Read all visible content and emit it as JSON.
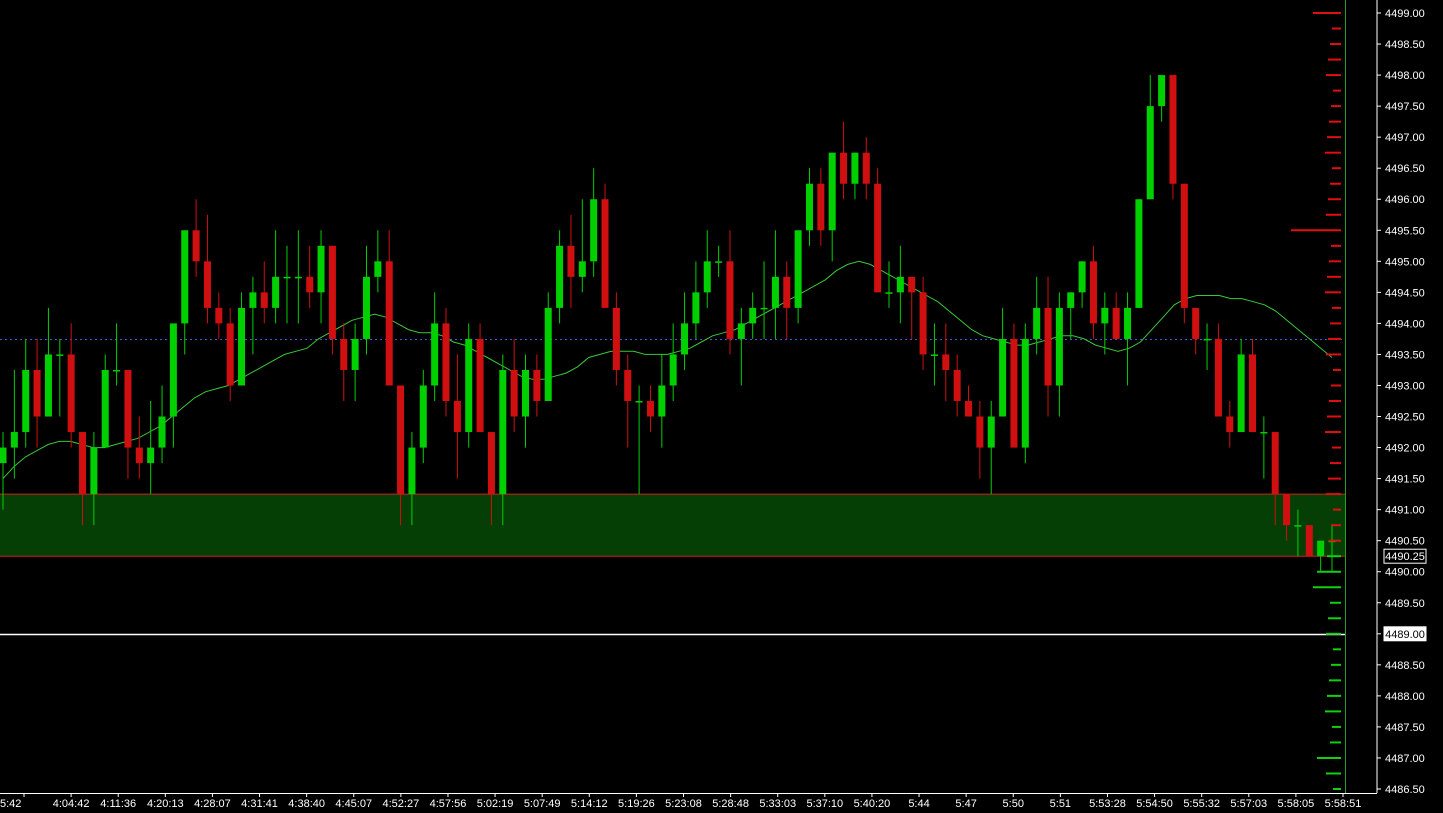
{
  "chart_data": {
    "type": "candlestick",
    "y_axis": {
      "min": 4486.5,
      "max": 4499.0,
      "ticks": [
        "4499.00",
        "4498.50",
        "4498.00",
        "4497.50",
        "4497.00",
        "4496.50",
        "4496.00",
        "4495.50",
        "4495.00",
        "4494.50",
        "4494.00",
        "4493.50",
        "4493.00",
        "4492.50",
        "4492.00",
        "4491.50",
        "4491.00",
        "4490.50",
        "4490.00",
        "4489.50",
        "4489.00",
        "4488.50",
        "4488.00",
        "4487.50",
        "4487.00",
        "4486.50"
      ]
    },
    "x_axis": {
      "labels": [
        "5:42",
        "4:04:42",
        "4:11:36",
        "4:20:13",
        "4:28:07",
        "4:31:41",
        "4:38:40",
        "4:45:07",
        "4:52:27",
        "4:57:56",
        "5:02:19",
        "5:07:49",
        "5:14:12",
        "5:19:26",
        "5:23:08",
        "5:28:48",
        "5:33:03",
        "5:37:10",
        "5:40:20",
        "5:44",
        "5:47",
        "5:50",
        "5:51",
        "5:53:28",
        "5:54:50",
        "5:55:32",
        "5:57:03",
        "5:58:05",
        "5:58:51"
      ]
    },
    "candles": [
      {
        "o": 4491.75,
        "h": 4492.25,
        "l": 4491.0,
        "c": 4492.0
      },
      {
        "o": 4492.0,
        "h": 4493.25,
        "l": 4491.5,
        "c": 4492.25
      },
      {
        "o": 4492.25,
        "h": 4493.75,
        "l": 4492.0,
        "c": 4493.25
      },
      {
        "o": 4493.25,
        "h": 4493.75,
        "l": 4492.0,
        "c": 4492.5
      },
      {
        "o": 4492.5,
        "h": 4494.25,
        "l": 4492.5,
        "c": 4493.5
      },
      {
        "o": 4493.5,
        "h": 4493.75,
        "l": 4492.5,
        "c": 4493.5
      },
      {
        "o": 4493.5,
        "h": 4494.0,
        "l": 4492.0,
        "c": 4492.25
      },
      {
        "o": 4492.25,
        "h": 4492.25,
        "l": 4490.75,
        "c": 4491.25
      },
      {
        "o": 4491.25,
        "h": 4492.25,
        "l": 4490.75,
        "c": 4492.0
      },
      {
        "o": 4492.0,
        "h": 4493.5,
        "l": 4492.0,
        "c": 4493.25
      },
      {
        "o": 4493.25,
        "h": 4494.0,
        "l": 4493.0,
        "c": 4493.25
      },
      {
        "o": 4493.25,
        "h": 4493.25,
        "l": 4491.5,
        "c": 4492.0
      },
      {
        "o": 4492.0,
        "h": 4492.5,
        "l": 4491.5,
        "c": 4491.75
      },
      {
        "o": 4491.75,
        "h": 4492.75,
        "l": 4491.25,
        "c": 4492.0
      },
      {
        "o": 4492.0,
        "h": 4493.0,
        "l": 4491.75,
        "c": 4492.5
      },
      {
        "o": 4492.5,
        "h": 4493.75,
        "l": 4492.0,
        "c": 4494.0
      },
      {
        "o": 4494.0,
        "h": 4495.5,
        "l": 4493.5,
        "c": 4495.5
      },
      {
        "o": 4495.5,
        "h": 4496.0,
        "l": 4494.75,
        "c": 4495.0
      },
      {
        "o": 4495.0,
        "h": 4495.75,
        "l": 4494.0,
        "c": 4494.25
      },
      {
        "o": 4494.25,
        "h": 4494.5,
        "l": 4493.75,
        "c": 4494.0
      },
      {
        "o": 4494.0,
        "h": 4494.25,
        "l": 4492.75,
        "c": 4493.0
      },
      {
        "o": 4493.0,
        "h": 4494.5,
        "l": 4493.0,
        "c": 4494.25
      },
      {
        "o": 4494.25,
        "h": 4494.75,
        "l": 4493.5,
        "c": 4494.5
      },
      {
        "o": 4494.5,
        "h": 4495.0,
        "l": 4494.0,
        "c": 4494.25
      },
      {
        "o": 4494.25,
        "h": 4495.5,
        "l": 4494.0,
        "c": 4494.75
      },
      {
        "o": 4494.75,
        "h": 4495.25,
        "l": 4494.0,
        "c": 4494.75
      },
      {
        "o": 4494.75,
        "h": 4495.5,
        "l": 4494.0,
        "c": 4494.75
      },
      {
        "o": 4494.75,
        "h": 4495.25,
        "l": 4494.25,
        "c": 4494.5
      },
      {
        "o": 4494.5,
        "h": 4495.5,
        "l": 4494.0,
        "c": 4495.25
      },
      {
        "o": 4495.25,
        "h": 4495.25,
        "l": 4493.5,
        "c": 4493.75
      },
      {
        "o": 4493.75,
        "h": 4494.0,
        "l": 4492.75,
        "c": 4493.25
      },
      {
        "o": 4493.25,
        "h": 4494.0,
        "l": 4492.75,
        "c": 4493.75
      },
      {
        "o": 4493.75,
        "h": 4495.25,
        "l": 4493.5,
        "c": 4494.75
      },
      {
        "o": 4494.75,
        "h": 4495.5,
        "l": 4494.5,
        "c": 4495.0
      },
      {
        "o": 4495.0,
        "h": 4495.5,
        "l": 4493.0,
        "c": 4493.0
      },
      {
        "o": 4493.0,
        "h": 4493.0,
        "l": 4490.75,
        "c": 4491.25
      },
      {
        "o": 4491.25,
        "h": 4492.25,
        "l": 4490.75,
        "c": 4492.0
      },
      {
        "o": 4492.0,
        "h": 4493.25,
        "l": 4491.75,
        "c": 4493.0
      },
      {
        "o": 4493.0,
        "h": 4494.5,
        "l": 4492.75,
        "c": 4494.0
      },
      {
        "o": 4494.0,
        "h": 4494.25,
        "l": 4492.5,
        "c": 4492.75
      },
      {
        "o": 4492.75,
        "h": 4493.5,
        "l": 4491.5,
        "c": 4492.25
      },
      {
        "o": 4492.25,
        "h": 4494.0,
        "l": 4492.0,
        "c": 4493.75
      },
      {
        "o": 4493.75,
        "h": 4494.0,
        "l": 4492.25,
        "c": 4492.25
      },
      {
        "o": 4492.25,
        "h": 4492.25,
        "l": 4490.75,
        "c": 4491.25
      },
      {
        "o": 4491.25,
        "h": 4493.5,
        "l": 4490.75,
        "c": 4493.25
      },
      {
        "o": 4493.25,
        "h": 4493.75,
        "l": 4492.25,
        "c": 4492.5
      },
      {
        "o": 4492.5,
        "h": 4493.5,
        "l": 4492.0,
        "c": 4493.25
      },
      {
        "o": 4493.25,
        "h": 4493.5,
        "l": 4492.5,
        "c": 4492.75
      },
      {
        "o": 4492.75,
        "h": 4494.5,
        "l": 4492.75,
        "c": 4494.25
      },
      {
        "o": 4494.25,
        "h": 4495.5,
        "l": 4494.0,
        "c": 4495.25
      },
      {
        "o": 4495.25,
        "h": 4495.75,
        "l": 4494.25,
        "c": 4494.75
      },
      {
        "o": 4494.75,
        "h": 4496.0,
        "l": 4494.5,
        "c": 4495.0
      },
      {
        "o": 4495.0,
        "h": 4496.5,
        "l": 4494.75,
        "c": 4496.0
      },
      {
        "o": 4496.0,
        "h": 4496.25,
        "l": 4494.25,
        "c": 4494.25
      },
      {
        "o": 4494.25,
        "h": 4494.5,
        "l": 4493.0,
        "c": 4493.25
      },
      {
        "o": 4493.25,
        "h": 4493.5,
        "l": 4492.0,
        "c": 4492.75
      },
      {
        "o": 4492.75,
        "h": 4493.0,
        "l": 4491.25,
        "c": 4492.75
      },
      {
        "o": 4492.75,
        "h": 4493.0,
        "l": 4492.25,
        "c": 4492.5
      },
      {
        "o": 4492.5,
        "h": 4493.5,
        "l": 4492.0,
        "c": 4493.0
      },
      {
        "o": 4493.0,
        "h": 4494.0,
        "l": 4492.75,
        "c": 4493.5
      },
      {
        "o": 4493.5,
        "h": 4494.5,
        "l": 4493.25,
        "c": 4494.0
      },
      {
        "o": 4494.0,
        "h": 4495.0,
        "l": 4493.75,
        "c": 4494.5
      },
      {
        "o": 4494.5,
        "h": 4495.5,
        "l": 4494.25,
        "c": 4495.0
      },
      {
        "o": 4495.0,
        "h": 4495.25,
        "l": 4494.75,
        "c": 4495.0
      },
      {
        "o": 4495.0,
        "h": 4495.5,
        "l": 4493.5,
        "c": 4493.75
      },
      {
        "o": 4493.75,
        "h": 4494.25,
        "l": 4493.0,
        "c": 4494.0
      },
      {
        "o": 4494.0,
        "h": 4494.5,
        "l": 4493.75,
        "c": 4494.25
      },
      {
        "o": 4494.25,
        "h": 4495.0,
        "l": 4493.75,
        "c": 4494.25
      },
      {
        "o": 4494.25,
        "h": 4495.5,
        "l": 4493.75,
        "c": 4494.75
      },
      {
        "o": 4494.75,
        "h": 4495.0,
        "l": 4493.75,
        "c": 4494.25
      },
      {
        "o": 4494.25,
        "h": 4495.5,
        "l": 4494.0,
        "c": 4495.5
      },
      {
        "o": 4495.5,
        "h": 4496.5,
        "l": 4495.25,
        "c": 4496.25
      },
      {
        "o": 4496.25,
        "h": 4496.5,
        "l": 4495.25,
        "c": 4495.5
      },
      {
        "o": 4495.5,
        "h": 4496.75,
        "l": 4495.0,
        "c": 4496.75
      },
      {
        "o": 4496.75,
        "h": 4497.25,
        "l": 4496.0,
        "c": 4496.25
      },
      {
        "o": 4496.25,
        "h": 4496.75,
        "l": 4496.0,
        "c": 4496.75
      },
      {
        "o": 4496.75,
        "h": 4497.0,
        "l": 4496.0,
        "c": 4496.25
      },
      {
        "o": 4496.25,
        "h": 4496.5,
        "l": 4494.5,
        "c": 4494.5
      },
      {
        "o": 4494.5,
        "h": 4495.0,
        "l": 4494.25,
        "c": 4494.5
      },
      {
        "o": 4494.5,
        "h": 4495.25,
        "l": 4494.0,
        "c": 4494.75
      },
      {
        "o": 4494.75,
        "h": 4494.75,
        "l": 4493.75,
        "c": 4494.5
      },
      {
        "o": 4494.5,
        "h": 4494.75,
        "l": 4493.25,
        "c": 4493.5
      },
      {
        "o": 4493.5,
        "h": 4494.0,
        "l": 4493.0,
        "c": 4493.5
      },
      {
        "o": 4493.5,
        "h": 4494.0,
        "l": 4492.75,
        "c": 4493.25
      },
      {
        "o": 4493.25,
        "h": 4493.5,
        "l": 4492.5,
        "c": 4492.75
      },
      {
        "o": 4492.75,
        "h": 4493.0,
        "l": 4492.5,
        "c": 4492.5
      },
      {
        "o": 4492.5,
        "h": 4492.75,
        "l": 4491.5,
        "c": 4492.0
      },
      {
        "o": 4492.0,
        "h": 4492.75,
        "l": 4491.25,
        "c": 4492.5
      },
      {
        "o": 4492.5,
        "h": 4494.25,
        "l": 4492.5,
        "c": 4493.75
      },
      {
        "o": 4493.75,
        "h": 4494.0,
        "l": 4492.0,
        "c": 4492.0
      },
      {
        "o": 4492.0,
        "h": 4494.0,
        "l": 4491.75,
        "c": 4493.75
      },
      {
        "o": 4493.75,
        "h": 4494.75,
        "l": 4493.5,
        "c": 4494.25
      },
      {
        "o": 4494.25,
        "h": 4494.75,
        "l": 4492.5,
        "c": 4493.0
      },
      {
        "o": 4493.0,
        "h": 4494.5,
        "l": 4492.5,
        "c": 4494.25
      },
      {
        "o": 4494.25,
        "h": 4494.5,
        "l": 4493.75,
        "c": 4494.5
      },
      {
        "o": 4494.5,
        "h": 4495.0,
        "l": 4494.25,
        "c": 4495.0
      },
      {
        "o": 4495.0,
        "h": 4495.25,
        "l": 4493.75,
        "c": 4494.0
      },
      {
        "o": 4494.0,
        "h": 4494.5,
        "l": 4493.5,
        "c": 4494.25
      },
      {
        "o": 4494.25,
        "h": 4494.5,
        "l": 4493.75,
        "c": 4493.75
      },
      {
        "o": 4493.75,
        "h": 4494.5,
        "l": 4493.0,
        "c": 4494.25
      },
      {
        "o": 4494.25,
        "h": 4496.0,
        "l": 4494.25,
        "c": 4496.0
      },
      {
        "o": 4496.0,
        "h": 4498.0,
        "l": 4496.0,
        "c": 4497.5
      },
      {
        "o": 4497.5,
        "h": 4498.0,
        "l": 4497.25,
        "c": 4498.0
      },
      {
        "o": 4498.0,
        "h": 4498.0,
        "l": 4496.0,
        "c": 4496.25
      },
      {
        "o": 4496.25,
        "h": 4496.25,
        "l": 4494.0,
        "c": 4494.25
      },
      {
        "o": 4494.25,
        "h": 4494.25,
        "l": 4493.5,
        "c": 4493.75
      },
      {
        "o": 4493.75,
        "h": 4494.0,
        "l": 4493.25,
        "c": 4493.75
      },
      {
        "o": 4493.75,
        "h": 4494.0,
        "l": 4492.5,
        "c": 4492.5
      },
      {
        "o": 4492.5,
        "h": 4492.75,
        "l": 4492.0,
        "c": 4492.25
      },
      {
        "o": 4492.25,
        "h": 4493.75,
        "l": 4492.25,
        "c": 4493.5
      },
      {
        "o": 4493.5,
        "h": 4493.75,
        "l": 4492.25,
        "c": 4492.25
      },
      {
        "o": 4492.25,
        "h": 4492.5,
        "l": 4491.5,
        "c": 4492.25
      },
      {
        "o": 4492.25,
        "h": 4492.25,
        "l": 4490.75,
        "c": 4491.25
      },
      {
        "o": 4491.25,
        "h": 4491.25,
        "l": 4490.5,
        "c": 4490.75
      },
      {
        "o": 4490.75,
        "h": 4491.0,
        "l": 4490.25,
        "c": 4490.75
      },
      {
        "o": 4490.75,
        "h": 4490.75,
        "l": 4490.25,
        "c": 4490.25
      },
      {
        "o": 4490.25,
        "h": 4490.5,
        "l": 4490.0,
        "c": 4490.5
      },
      {
        "o": 4490.5,
        "h": 4490.75,
        "l": 4490.0,
        "c": 4490.5
      }
    ],
    "moving_average": [
      4491.5,
      4491.7,
      4491.85,
      4491.95,
      4492.05,
      4492.1,
      4492.1,
      4492.05,
      4492.0,
      4492.0,
      4492.05,
      4492.1,
      4492.15,
      4492.25,
      4492.35,
      4492.5,
      4492.65,
      4492.8,
      4492.9,
      4492.95,
      4493.0,
      4493.1,
      4493.2,
      4493.3,
      4493.4,
      4493.5,
      4493.55,
      4493.6,
      4493.75,
      4493.85,
      4493.95,
      4494.05,
      4494.1,
      4494.15,
      4494.1,
      4494.0,
      4493.9,
      4493.85,
      4493.85,
      4493.8,
      4493.7,
      4493.65,
      4493.55,
      4493.45,
      4493.35,
      4493.25,
      4493.15,
      4493.1,
      4493.1,
      4493.15,
      4493.2,
      4493.3,
      4493.45,
      4493.5,
      4493.55,
      4493.55,
      4493.55,
      4493.5,
      4493.5,
      4493.5,
      4493.55,
      4493.6,
      4493.7,
      4493.8,
      4493.85,
      4493.9,
      4494.0,
      4494.1,
      4494.2,
      4494.3,
      4494.4,
      4494.5,
      4494.6,
      4494.7,
      4494.85,
      4494.95,
      4495.0,
      4494.95,
      4494.85,
      4494.75,
      4494.65,
      4494.55,
      4494.45,
      4494.35,
      4494.2,
      4494.05,
      4493.9,
      4493.8,
      4493.75,
      4493.7,
      4493.65,
      4493.65,
      4493.7,
      4493.75,
      4493.8,
      4493.8,
      4493.75,
      4493.65,
      4493.6,
      4493.55,
      4493.6,
      4493.7,
      4493.9,
      4494.1,
      4494.3,
      4494.4,
      4494.45,
      4494.45,
      4494.45,
      4494.4,
      4494.4,
      4494.35,
      4494.3,
      4494.2,
      4494.05,
      4493.9,
      4493.75,
      4493.6,
      4493.45
    ],
    "levels": [
      {
        "name": "dotted-reference",
        "price": 4493.75,
        "style": "dotted",
        "color": "#3c5adc"
      },
      {
        "name": "current-price",
        "price": 4490.25,
        "label": "4490.25"
      },
      {
        "name": "reference-line",
        "price": 4489.0,
        "label": "4489.00",
        "color": "#ffffff"
      }
    ],
    "zone": {
      "from": 4490.25,
      "to": 4491.25,
      "fill": "#063f06",
      "border": "#d02020"
    },
    "colors": {
      "up": "#00d000",
      "down": "#d01010",
      "background": "#000000",
      "axis_text": "#ffffff",
      "moving_average": "#38c838",
      "axis_border": "#28a028",
      "up_ticks": "#10d010",
      "down_ticks": "#e01010"
    },
    "grid": false
  }
}
